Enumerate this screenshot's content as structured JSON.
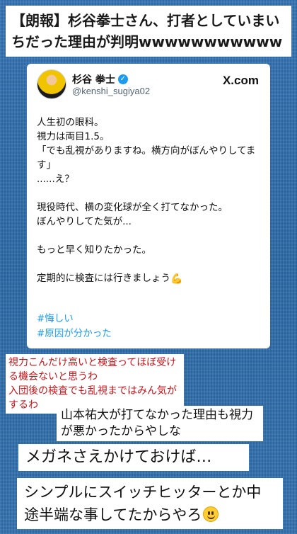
{
  "headline": "【朗報】杉谷拳士さん、打者としていまいちだった理由が判明wwwwwwwwwww",
  "tweet": {
    "name": "杉谷 拳士",
    "handle": "@kenshi_sugiya02",
    "brand": "X.com",
    "body": "人生初の眼科。\n視力は両目1.5。\n「でも乱視がありますね。横方向がぼんやりしてます」\n......え？\n\n現役時代、横の変化球が全く打てなかった。\nぼんやりしてた気が...\n\nもっと早く知りたかった。\n\n定期的に検査には行きましょう",
    "muscle_emoji": "💪",
    "hashtags": [
      "#悔しい",
      "#原因が分かった"
    ]
  },
  "comments": [
    {
      "text": "視力こんだけ高いと検査ってほぼ受ける機会ないと思うわ\n入団後の検査でも乱視まではみん気がするわ",
      "color": "#c8141a"
    },
    {
      "text": "山本祐大が打てなかった理由も視力が悪かったからやしな"
    },
    {
      "text": "メガネさえかけておけば…"
    },
    {
      "text": "シンプルにスイッチヒッターとか中途半端な事してたからやろ",
      "emoji": "smiling-face"
    }
  ],
  "colors": {
    "background": "#2f6eae",
    "hashtag": "#1d9bf0",
    "verified": "#1d9bf0",
    "red_comment": "#c8141a"
  }
}
